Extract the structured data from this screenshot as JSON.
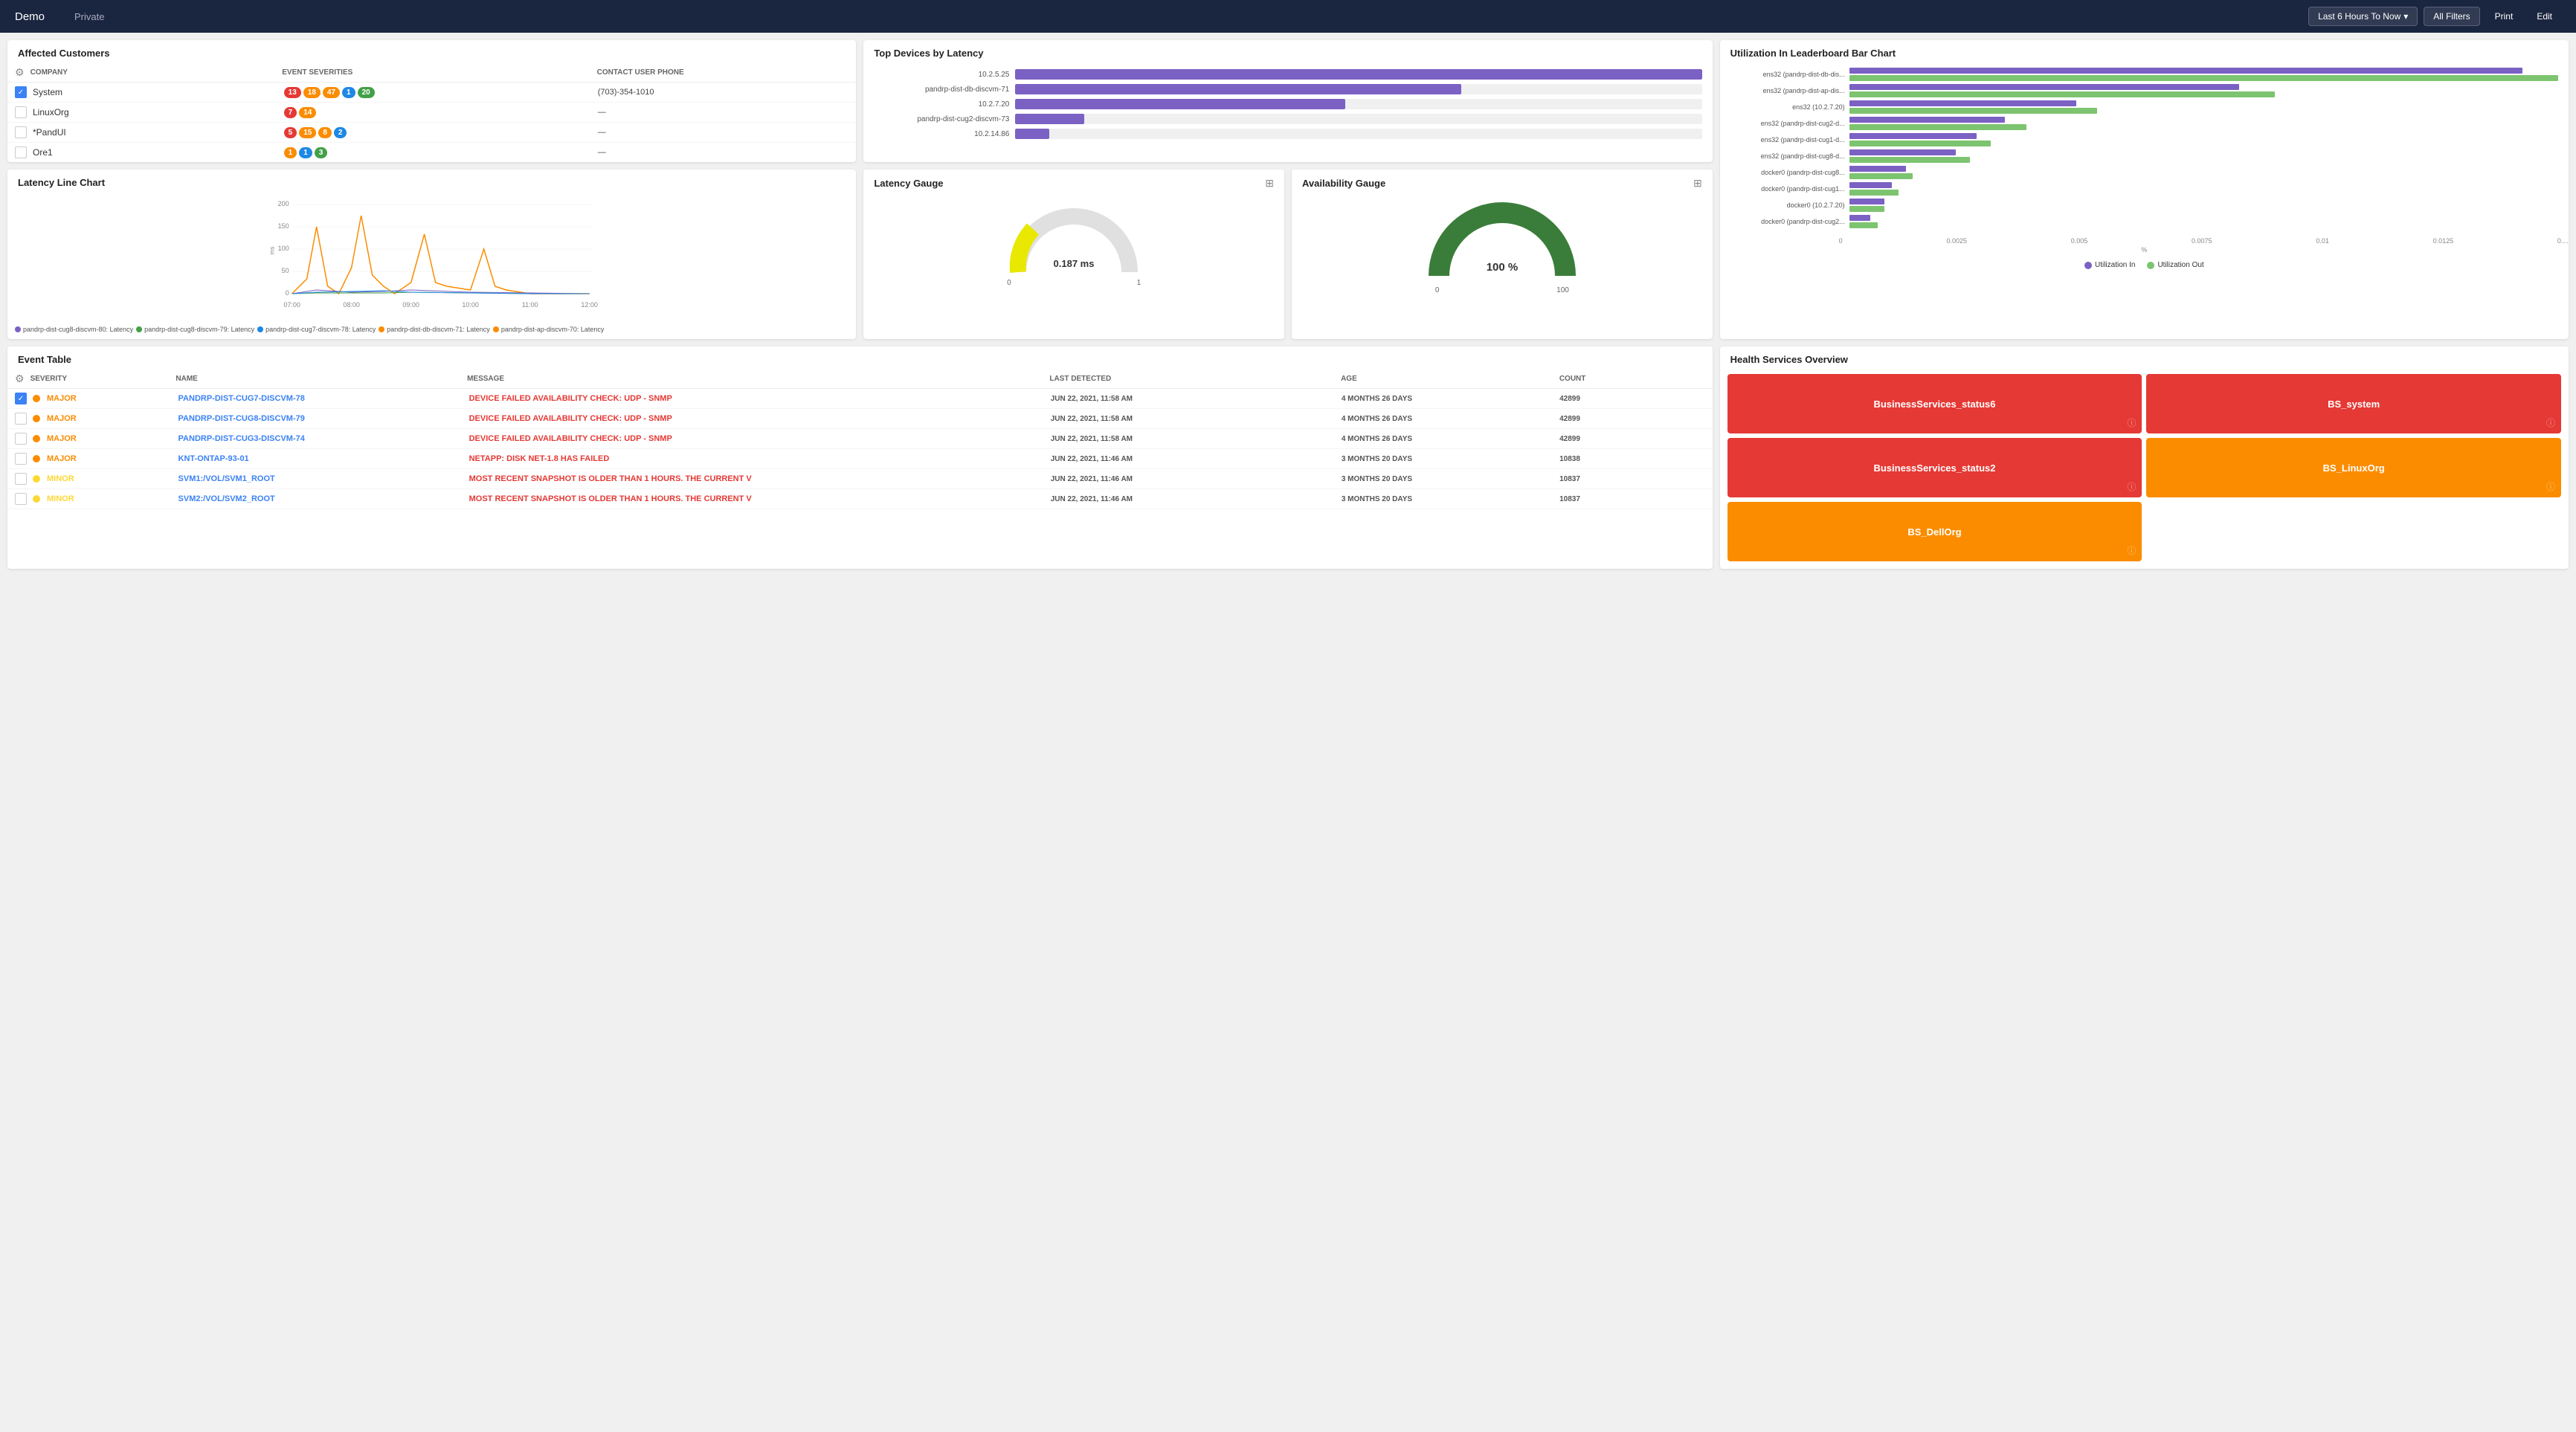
{
  "header": {
    "title": "Demo",
    "visibility": "Private",
    "time_filter": "Last 6 Hours To Now",
    "btn_all_filters": "All Filters",
    "btn_print": "Print",
    "btn_edit": "Edit"
  },
  "affected_customers": {
    "title": "Affected Customers",
    "columns": [
      "COMPANY",
      "EVENT SEVERITIES",
      "CONTACT USER PHONE"
    ],
    "rows": [
      {
        "checked": true,
        "company": "System",
        "badges": [
          {
            "val": "13",
            "color": "red"
          },
          {
            "val": "18",
            "color": "orange"
          },
          {
            "val": "47",
            "color": "orange"
          },
          {
            "val": "1",
            "color": "blue"
          },
          {
            "val": "20",
            "color": "green"
          }
        ],
        "phone": "(703)-354-1010"
      },
      {
        "checked": false,
        "company": "LinuxOrg",
        "badges": [
          {
            "val": "7",
            "color": "red"
          },
          {
            "val": "14",
            "color": "orange"
          }
        ],
        "phone": "—"
      },
      {
        "checked": false,
        "company": "*PandUI",
        "badges": [
          {
            "val": "5",
            "color": "red"
          },
          {
            "val": "15",
            "color": "orange"
          },
          {
            "val": "8",
            "color": "orange"
          },
          {
            "val": "2",
            "color": "blue"
          }
        ],
        "phone": "—"
      },
      {
        "checked": false,
        "company": "Ore1",
        "badges": [
          {
            "val": "1",
            "color": "orange"
          },
          {
            "val": "1",
            "color": "blue"
          },
          {
            "val": "3",
            "color": "green"
          }
        ],
        "phone": "—"
      }
    ]
  },
  "top_devices": {
    "title": "Top Devices by Latency",
    "bars": [
      {
        "label": "10.2.5.25",
        "pct": 100
      },
      {
        "label": "pandrp-dist-db-discvm-71",
        "pct": 65
      },
      {
        "label": "10.2.7.20",
        "pct": 48
      },
      {
        "label": "pandrp-dist-cug2-discvm-73",
        "pct": 10
      },
      {
        "label": "10.2.14.86",
        "pct": 5
      }
    ]
  },
  "utilization": {
    "title": "Utilization In Leaderboard Bar Chart",
    "rows": [
      {
        "label": "ens32 (pandrp-dist-db-dis...",
        "in_pct": 95,
        "out_pct": 100
      },
      {
        "label": "ens32 (pandrp-dist-ap-dis...",
        "in_pct": 55,
        "out_pct": 60
      },
      {
        "label": "ens32 (10.2.7.20)",
        "in_pct": 32,
        "out_pct": 35
      },
      {
        "label": "ens32 (pandrp-dist-cug2-d...",
        "in_pct": 22,
        "out_pct": 25
      },
      {
        "label": "ens32 (pandrp-dist-cug1-d...",
        "in_pct": 18,
        "out_pct": 20
      },
      {
        "label": "ens32 (pandrp-dist-cug8-d...",
        "in_pct": 15,
        "out_pct": 17
      },
      {
        "label": "docker0 (pandrp-dist-cug8...",
        "in_pct": 8,
        "out_pct": 9
      },
      {
        "label": "docker0 (pandrp-dist-cug1...",
        "in_pct": 6,
        "out_pct": 7
      },
      {
        "label": "docker0 (10.2.7.20)",
        "in_pct": 5,
        "out_pct": 5
      },
      {
        "label": "docker0 (pandrp-dist-cug2...",
        "in_pct": 3,
        "out_pct": 4
      }
    ],
    "x_labels": [
      "0",
      "0.0025",
      "0.005",
      "0.0075",
      "0.01",
      "0.0125",
      "0...."
    ],
    "x_unit": "%",
    "legend_in": "Utilization In",
    "legend_out": "Utilization Out"
  },
  "latency_chart": {
    "title": "Latency Line Chart",
    "y_labels": [
      "200",
      "150",
      "100",
      "50",
      "0"
    ],
    "x_labels": [
      "07:00",
      "08:00",
      "09:00",
      "10:00",
      "11:00",
      "12:00"
    ],
    "y_unit": "ms",
    "legend": [
      {
        "label": "pandrp-dist-cug8-discvm-80: Latency",
        "color": "#7b61c4"
      },
      {
        "label": "pandrp-dist-cug8-discvm-79: Latency",
        "color": "#43a047"
      },
      {
        "label": "pandrp-dist-cug7-discvm-78: Latency",
        "color": "#1e88e5"
      },
      {
        "label": "pandrp-dist-db-discvm-71: Latency",
        "color": "#fb8c00"
      },
      {
        "label": "pandrp-dist-ap-discvm-70: Latency",
        "color": "#fb8c00"
      }
    ]
  },
  "latency_gauge": {
    "title": "Latency Gauge",
    "value": "0.187 ms",
    "min": "0",
    "max": "1",
    "fill_pct": 18
  },
  "availability_gauge": {
    "title": "Availability Gauge",
    "value": "100 %",
    "min": "0",
    "max": "100",
    "fill_pct": 100
  },
  "health_services": {
    "title": "Health Services Overview",
    "cards": [
      {
        "label": "BusinessServices_status6",
        "color": "red"
      },
      {
        "label": "BS_system",
        "color": "red"
      },
      {
        "label": "BusinessServices_status2",
        "color": "red"
      },
      {
        "label": "BS_LinuxOrg",
        "color": "orange"
      },
      {
        "label": "BS_DellOrg",
        "color": "orange"
      }
    ]
  },
  "event_table": {
    "title": "Event Table",
    "columns": [
      "SEVERITY",
      "NAME",
      "MESSAGE",
      "LAST DETECTED",
      "AGE",
      "COUNT"
    ],
    "rows": [
      {
        "checked": true,
        "severity": "Major",
        "severity_type": "major",
        "name": "pandrp-dist-cug7-discvm-78",
        "message": "Device Failed Availability Check: UDP - SNMP",
        "detected": "Jun 22, 2021, 11:58 AM",
        "age": "4 months 26 days",
        "count": "42899"
      },
      {
        "checked": false,
        "severity": "Major",
        "severity_type": "major",
        "name": "pandrp-dist-cug8-discvm-79",
        "message": "Device Failed Availability Check: UDP - SNMP",
        "detected": "Jun 22, 2021, 11:58 AM",
        "age": "4 months 26 days",
        "count": "42899"
      },
      {
        "checked": false,
        "severity": "Major",
        "severity_type": "major",
        "name": "pandrp-dist-cug3-discvm-74",
        "message": "Device Failed Availability Check: UDP - SNMP",
        "detected": "Jun 22, 2021, 11:58 AM",
        "age": "4 months 26 days",
        "count": "42899"
      },
      {
        "checked": false,
        "severity": "Major",
        "severity_type": "major",
        "name": "KNT-ONTAP-93-01",
        "message": "NetApp: Disk NET-1.8 has failed",
        "detected": "Jun 22, 2021, 11:46 AM",
        "age": "3 months 20 days",
        "count": "10838"
      },
      {
        "checked": false,
        "severity": "Minor",
        "severity_type": "minor",
        "name": "SVM1:/vol/SVM1_root",
        "message": "Most recent snapshot is older than 1 Hours. The current v",
        "detected": "Jun 22, 2021, 11:46 AM",
        "age": "3 months 20 days",
        "count": "10837"
      },
      {
        "checked": false,
        "severity": "Minor",
        "severity_type": "minor",
        "name": "SVM2:/vol/SVM2_root",
        "message": "Most recent snapshot is older than 1 Hours. The current v",
        "detected": "Jun 22, 2021, 11:46 AM",
        "age": "3 months 20 days",
        "count": "10837"
      }
    ]
  }
}
